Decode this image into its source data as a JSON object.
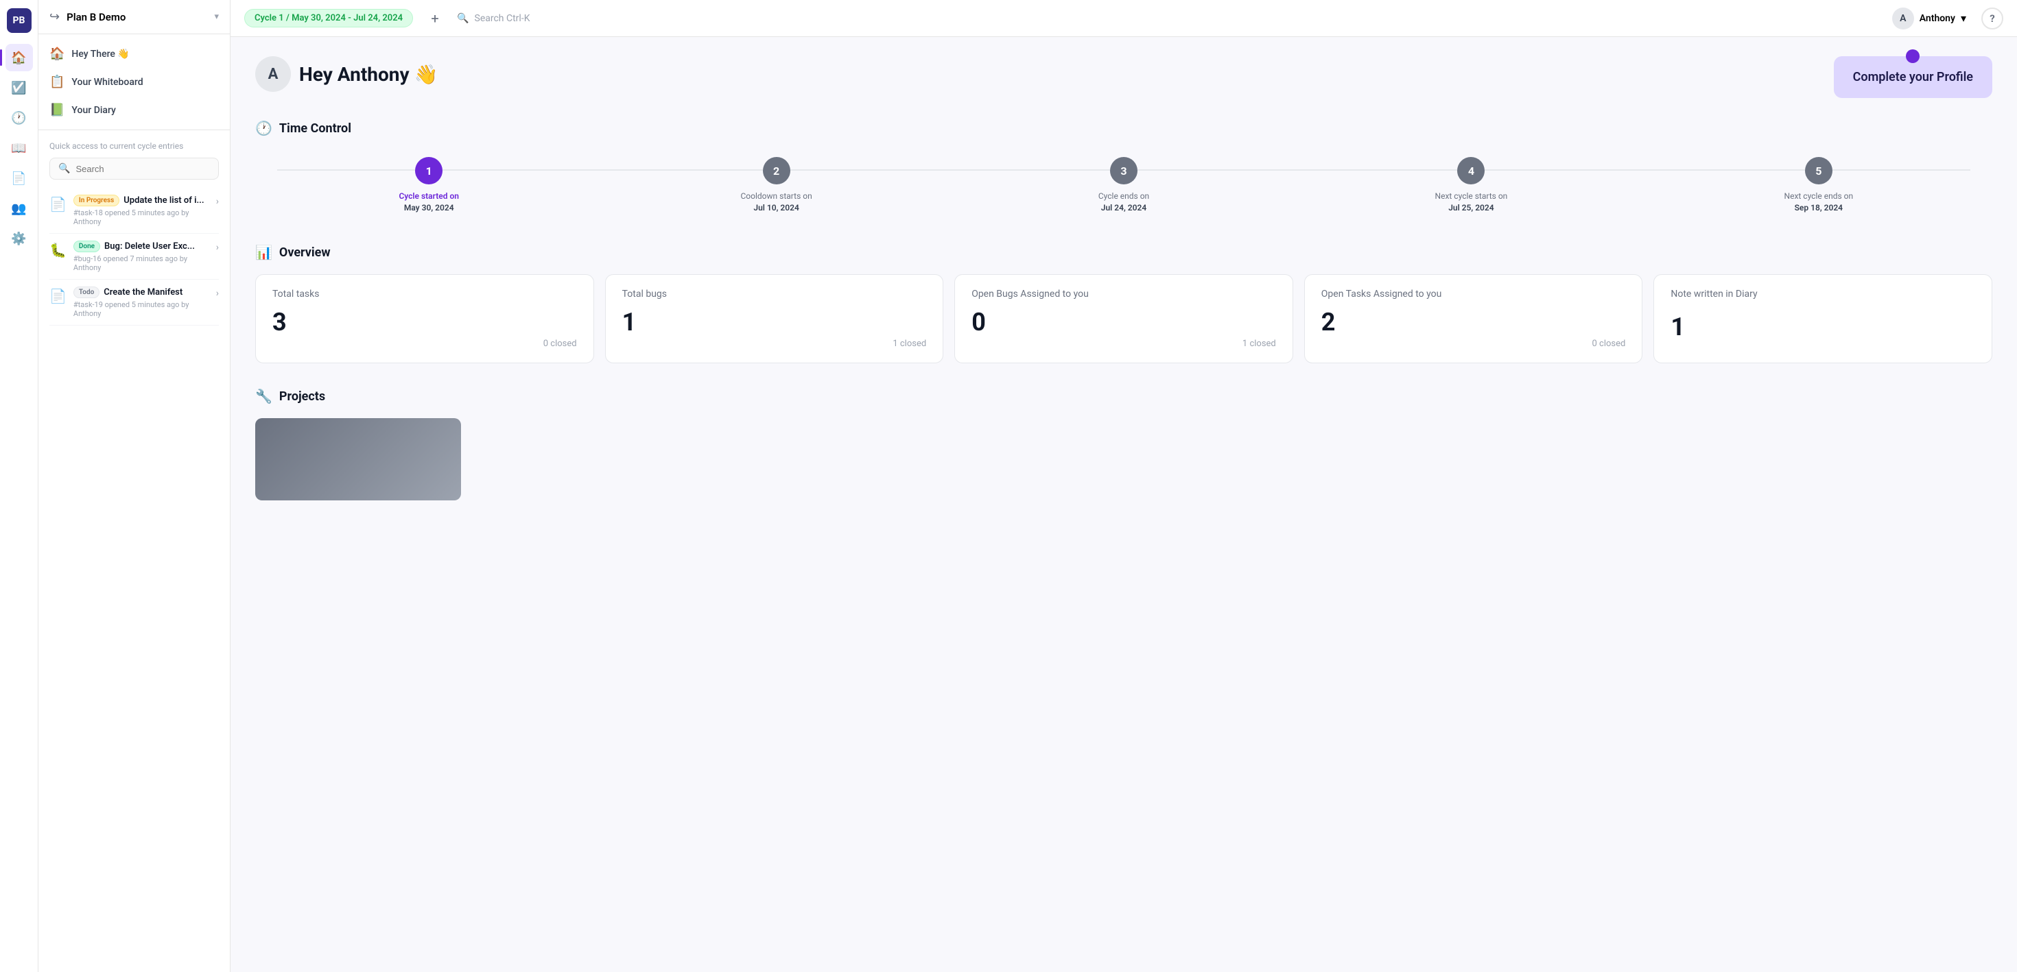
{
  "logo": {
    "text": "PB"
  },
  "workspace": {
    "name": "Plan B Demo",
    "chevron": "▾"
  },
  "nav": {
    "items": [
      {
        "id": "home",
        "icon": "🏠",
        "label": "Home",
        "active": true
      },
      {
        "id": "tasks",
        "icon": "✅",
        "label": "Tasks",
        "active": false
      },
      {
        "id": "clock",
        "icon": "🕐",
        "label": "Clock",
        "active": false
      },
      {
        "id": "book",
        "icon": "📖",
        "label": "Book",
        "active": false
      },
      {
        "id": "page",
        "icon": "📄",
        "label": "Page",
        "active": false
      },
      {
        "id": "people",
        "icon": "👥",
        "label": "People",
        "active": false
      },
      {
        "id": "settings",
        "icon": "⚙️",
        "label": "Settings",
        "active": false
      }
    ]
  },
  "left_panel": {
    "nav_items": [
      {
        "id": "hey-there",
        "icon": "🏠",
        "label": "Hey There 👋"
      },
      {
        "id": "whiteboard",
        "icon": "📋",
        "label": "Your Whiteboard"
      },
      {
        "id": "diary",
        "icon": "📗",
        "label": "Your Diary"
      }
    ],
    "quick_access_title": "Quick access to current cycle entries",
    "search_placeholder": "Search",
    "entries": [
      {
        "id": "entry-1",
        "badge": "In Progress",
        "badge_type": "inprogress",
        "title": "Update the list of i...",
        "meta": "#task-18 opened 5 minutes ago by Anthony",
        "icon": "📄"
      },
      {
        "id": "entry-2",
        "badge": "Done",
        "badge_type": "done",
        "title": "Bug: Delete User Exc...",
        "meta": "#bug-16 opened 7 minutes ago by Anthony",
        "icon": "🐛"
      },
      {
        "id": "entry-3",
        "badge": "Todo",
        "badge_type": "todo",
        "title": "Create the Manifest",
        "meta": "#task-19 opened 5 minutes ago by Anthony",
        "icon": "📄"
      }
    ]
  },
  "topbar": {
    "cycle_label": "Cycle 1 / May 30, 2024 - Jul 24, 2024",
    "add_icon": "+",
    "search_placeholder": "Search Ctrl-K",
    "user": {
      "name": "Anthony",
      "avatar_letter": "A",
      "chevron": "▾"
    },
    "help_label": "?"
  },
  "hero": {
    "avatar_letter": "A",
    "greeting": "Hey Anthony 👋",
    "profile_card": {
      "dot": true,
      "title": "Complete your Profile"
    }
  },
  "time_control": {
    "section_label": "Time Control",
    "steps": [
      {
        "num": "1",
        "active": true,
        "label": "Cycle started on",
        "label_active": true,
        "date": "May 30, 2024"
      },
      {
        "num": "2",
        "active": false,
        "label": "Cooldown starts on",
        "date": "Jul 10, 2024"
      },
      {
        "num": "3",
        "active": false,
        "label": "Cycle ends on",
        "date": "Jul 24, 2024"
      },
      {
        "num": "4",
        "active": false,
        "label": "Next cycle starts on",
        "date": "Jul 25, 2024"
      },
      {
        "num": "5",
        "active": false,
        "label": "Next cycle ends on",
        "date": "Sep 18, 2024"
      }
    ]
  },
  "overview": {
    "section_label": "Overview",
    "cards": [
      {
        "id": "total-tasks",
        "label": "Total tasks",
        "value": "3",
        "footer": "0 closed"
      },
      {
        "id": "total-bugs",
        "label": "Total bugs",
        "value": "1",
        "footer": "1 closed"
      },
      {
        "id": "open-bugs-assigned",
        "label": "Open Bugs Assigned to you",
        "value": "0",
        "footer": "1 closed"
      },
      {
        "id": "open-tasks-assigned",
        "label": "Open Tasks Assigned to you",
        "value": "2",
        "footer": "0 closed"
      },
      {
        "id": "notes-diary",
        "label": "Note written in Diary",
        "value": "1",
        "footer": ""
      }
    ]
  },
  "projects": {
    "section_label": "Projects"
  }
}
